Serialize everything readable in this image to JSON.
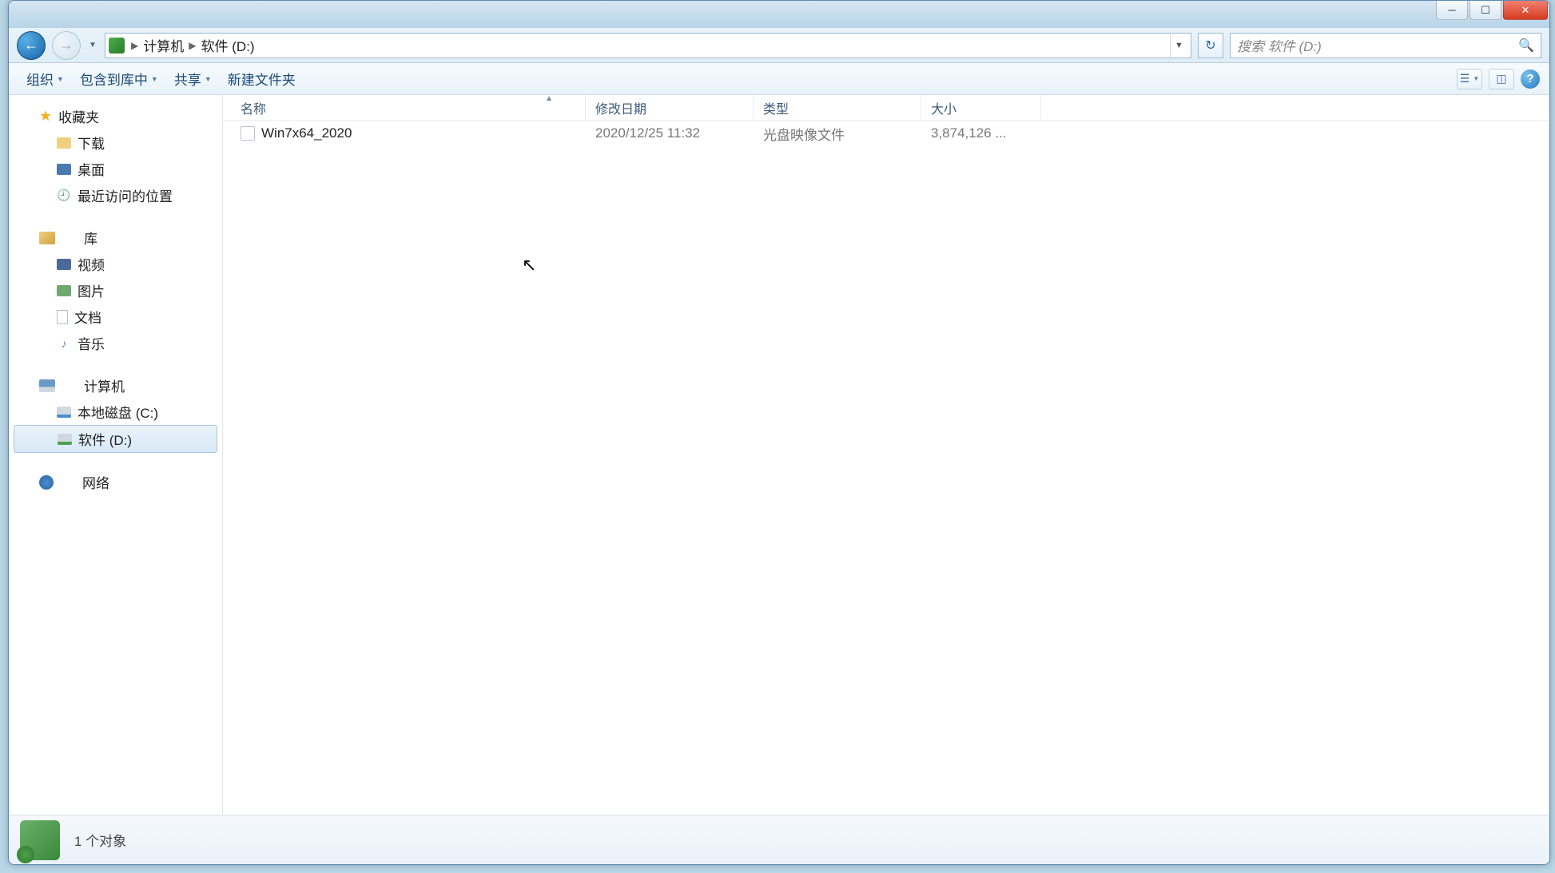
{
  "breadcrumbs": {
    "seg1": "计算机",
    "seg2": "软件 (D:)"
  },
  "search": {
    "placeholder": "搜索 软件 (D:)"
  },
  "toolbar": {
    "organize": "组织",
    "include": "包含到库中",
    "share": "共享",
    "newfolder": "新建文件夹"
  },
  "sidebar": {
    "favorites": "收藏夹",
    "downloads": "下载",
    "desktop": "桌面",
    "recent": "最近访问的位置",
    "libraries": "库",
    "videos": "视频",
    "pictures": "图片",
    "documents": "文档",
    "music": "音乐",
    "computer": "计算机",
    "drive_c": "本地磁盘 (C:)",
    "drive_d": "软件 (D:)",
    "network": "网络"
  },
  "columns": {
    "name": "名称",
    "date": "修改日期",
    "type": "类型",
    "size": "大小"
  },
  "files": [
    {
      "name": "Win7x64_2020",
      "date": "2020/12/25 11:32",
      "type": "光盘映像文件",
      "size": "3,874,126 ..."
    }
  ],
  "status": {
    "text": "1 个对象"
  }
}
